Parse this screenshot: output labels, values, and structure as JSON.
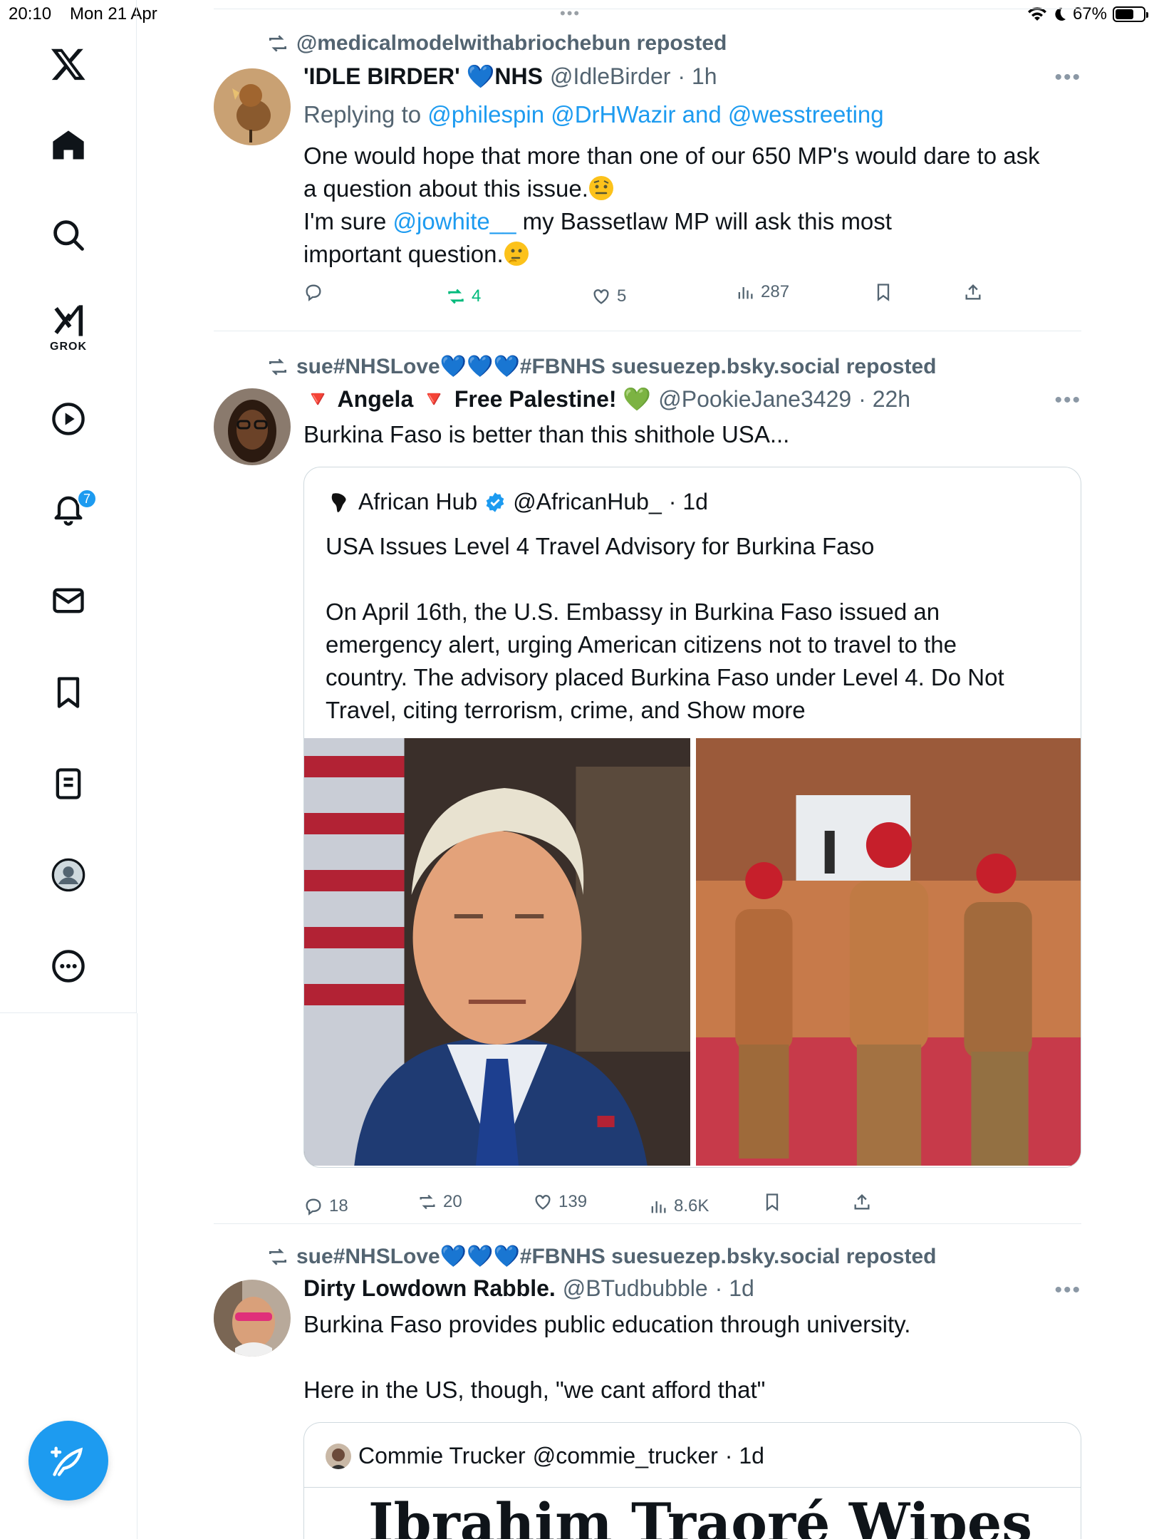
{
  "status_bar": {
    "time": "20:10",
    "date": "Mon 21 Apr",
    "battery": "67%",
    "battery_level": 0.67
  },
  "sidebar": {
    "grok_label": "GROK",
    "notification_count": "7"
  },
  "tweets": [
    {
      "repost_by": "@medicalmodelwithabriochebun reposted",
      "name": "'IDLE BIRDER' 💙NHS",
      "handle": "@IdleBirder",
      "time": "· 1h",
      "replying_prefix": "Replying to",
      "replying_to": "@philespin @DrHWazir and @wesstreeting",
      "text_line1": "One would hope that more than one of our 650 MP's would dare to ask",
      "text_line2": "a question about this issue.",
      "text_line3a": "I'm sure",
      "text_line3_link": "@jowhite__",
      "text_line3b": "my Bassetlaw MP will ask this most",
      "text_line4": "important question.",
      "replies": "",
      "reposts": "4",
      "likes": "5",
      "views": "287"
    },
    {
      "repost_by": "sue#NHSLove💙💙💙#FBNHS suesuezep.bsky.social reposted",
      "name": "🔻 Angela 🔻 Free Palestine! 💚",
      "handle": "@PookieJane3429",
      "time": "· 22h",
      "text": "Burkina Faso is better than this shithole USA...",
      "quote": {
        "name": "African Hub",
        "handle": "@AfricanHub_",
        "time": "· 1d",
        "line1": "USA Issues Level 4 Travel Advisory for Burkina Faso",
        "line2": "On April 16th, the U.S. Embassy in Burkina Faso issued an",
        "line3": "emergency alert, urging American citizens not to travel to the",
        "line4": "country. The advisory placed Burkina Faso under Level 4. Do Not",
        "line5": "Travel, citing terrorism, crime, and Show more"
      },
      "replies": "18",
      "reposts": "20",
      "likes": "139",
      "views": "8.6K"
    },
    {
      "repost_by": "sue#NHSLove💙💙💙#FBNHS suesuezep.bsky.social reposted",
      "name": "Dirty Lowdown Rabble.",
      "handle": "@BTudbubble",
      "time": "· 1d",
      "text_line1": "Burkina Faso provides public education through university.",
      "text_line2": "Here in the US, though, \"we cant afford that\"",
      "quote": {
        "name": "Commie Trucker",
        "handle": "@commie_trucker",
        "time": "· 1d",
        "headline": "Ibrahim Traoré Wipes"
      }
    }
  ],
  "colors": {
    "accent": "#1d9bf0",
    "repost_green": "#00ba7c",
    "muted": "#536471"
  }
}
